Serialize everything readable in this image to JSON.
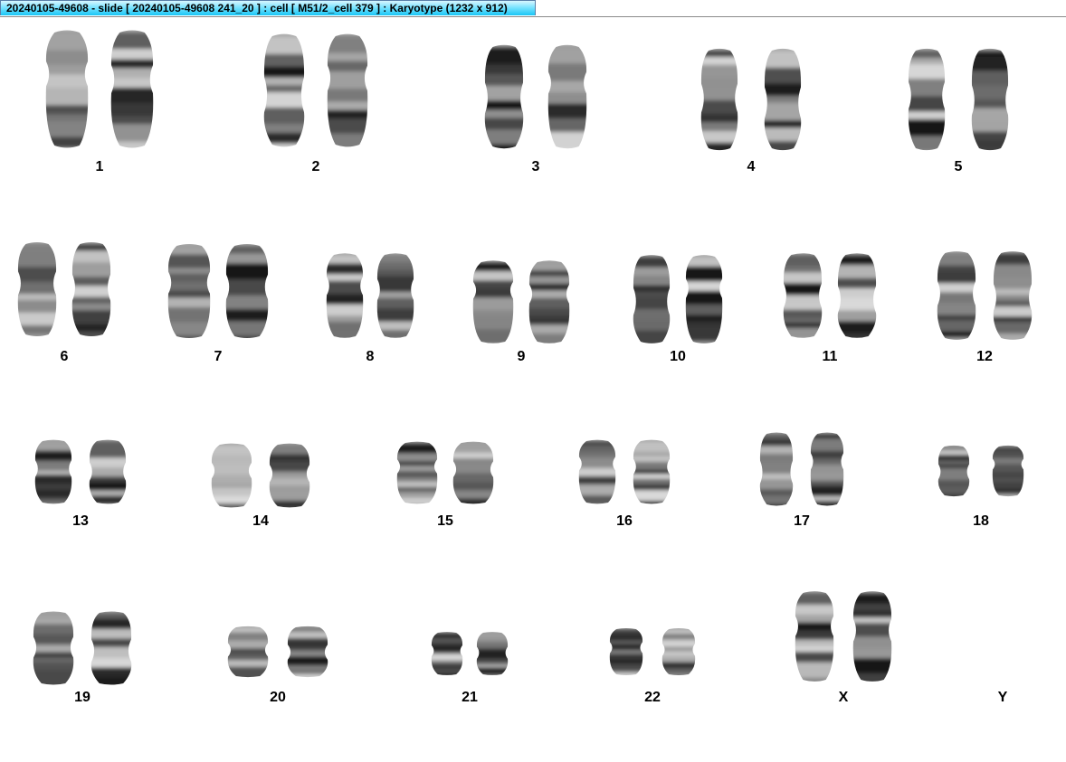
{
  "window": {
    "title": "20240105-49608 - slide [ 20240105-49608 241_20 ] : cell [ M51/2_cell 379 ] : Karyotype  (1232 x 912)"
  },
  "chromosomes": [
    {
      "label": "1"
    },
    {
      "label": "2"
    },
    {
      "label": "3"
    },
    {
      "label": "4"
    },
    {
      "label": "5"
    },
    {
      "label": "6"
    },
    {
      "label": "7"
    },
    {
      "label": "8"
    },
    {
      "label": "9"
    },
    {
      "label": "10"
    },
    {
      "label": "11"
    },
    {
      "label": "12"
    },
    {
      "label": "13"
    },
    {
      "label": "14"
    },
    {
      "label": "15"
    },
    {
      "label": "16"
    },
    {
      "label": "17"
    },
    {
      "label": "18"
    },
    {
      "label": "19"
    },
    {
      "label": "20"
    },
    {
      "label": "21"
    },
    {
      "label": "22"
    },
    {
      "label": "X"
    },
    {
      "label": "Y"
    }
  ]
}
